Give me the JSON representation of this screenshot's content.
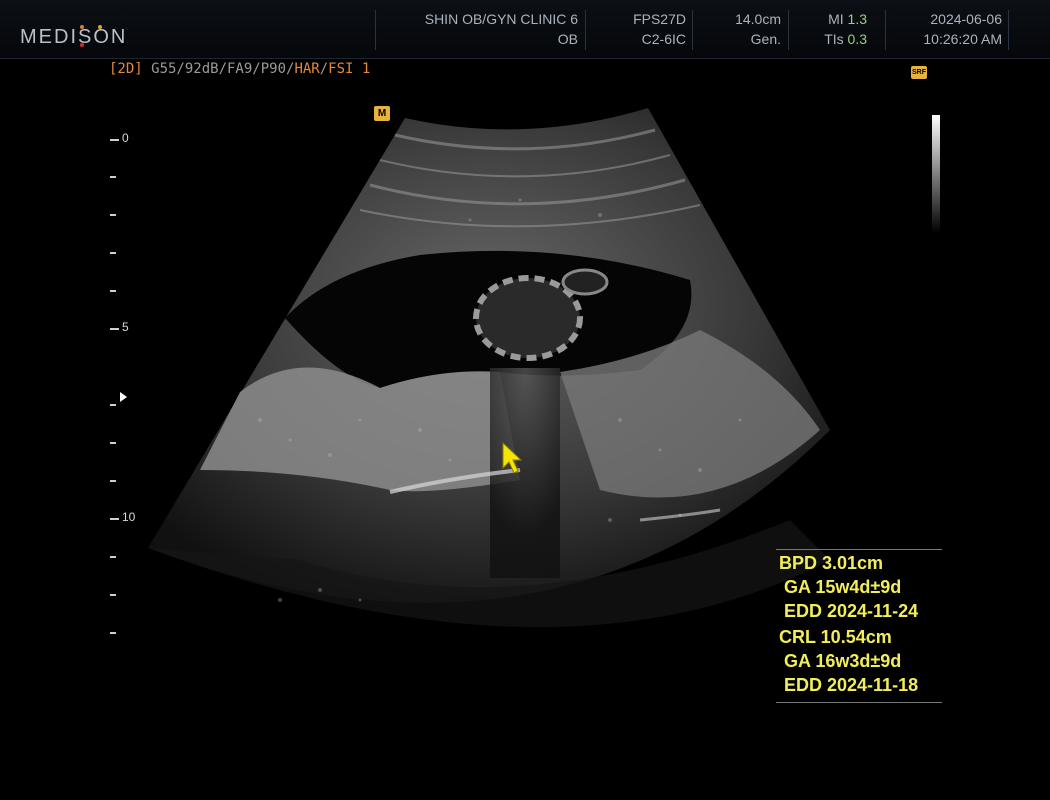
{
  "header": {
    "logo": "MEDISON",
    "clinic": "SHIN OB/GYN CLINIC 6",
    "exam": "OB",
    "frame_rate": "FPS27D",
    "probe": "C2-6IC",
    "depth": "14.0cm",
    "mode": "Gen.",
    "mi_label": "MI",
    "mi_value": "1.3",
    "tis_label": "TIs",
    "tis_value": "0.3",
    "date": "2024-06-06",
    "time": "10:26:20 AM"
  },
  "status_line": {
    "mode": "[2D]",
    "params": " G55/92dB/FA9/P90/",
    "harmonic": "HAR",
    "separator": "/",
    "fsi": "FSI 1"
  },
  "badges": {
    "sri": "SRF",
    "marker": "M"
  },
  "ruler": {
    "labels": [
      "0",
      "5",
      "10"
    ]
  },
  "measurements": {
    "lines": [
      "BPD 3.01cm",
      " GA 15w4d±9d",
      " EDD 2024-11-24",
      "CRL 10.54cm",
      " GA 16w3d±9d",
      " EDD 2024-11-18"
    ]
  },
  "colors": {
    "measurement_text": "#f2ee5a",
    "highlight_value": "#9ccf74",
    "status_orange": "#e08a3c",
    "badge": "#e8b23e",
    "cursor": "#f4e600"
  },
  "icons": {
    "cursor": "arrow-pointer-icon",
    "focus": "focus-marker-icon"
  }
}
